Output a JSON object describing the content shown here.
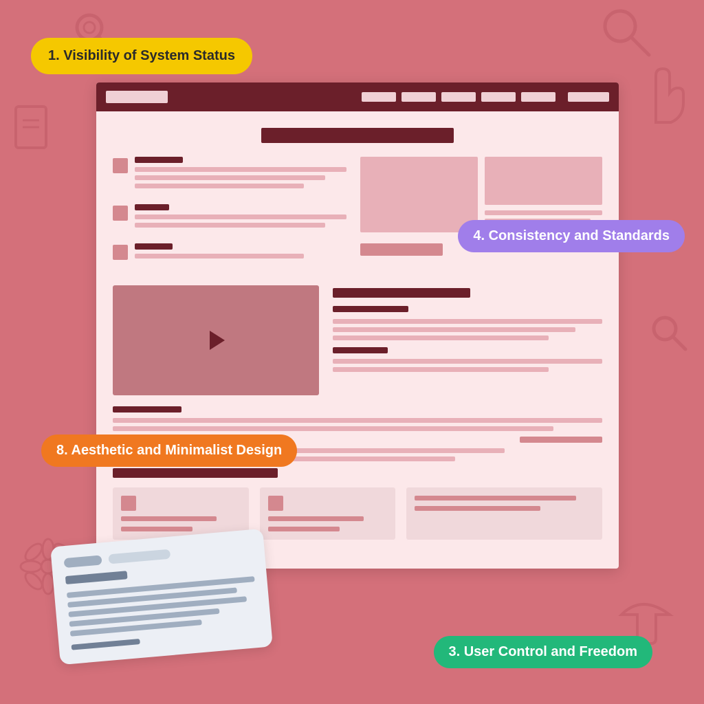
{
  "background": {
    "color": "#d4707a"
  },
  "tooltips": {
    "t1": {
      "label": "1. Visibility of System Status",
      "style": "yellow"
    },
    "t2": {
      "label": "4. Consistency and Standards",
      "style": "purple"
    },
    "t3": {
      "label": "8. Aesthetic and Minimalist Design",
      "style": "orange"
    },
    "t4": {
      "label": "3. User Control and Freedom",
      "style": "green"
    }
  },
  "browser": {
    "nav": {
      "logo": "",
      "links": [
        "",
        "",
        "",
        "",
        ""
      ],
      "cta": ""
    }
  }
}
